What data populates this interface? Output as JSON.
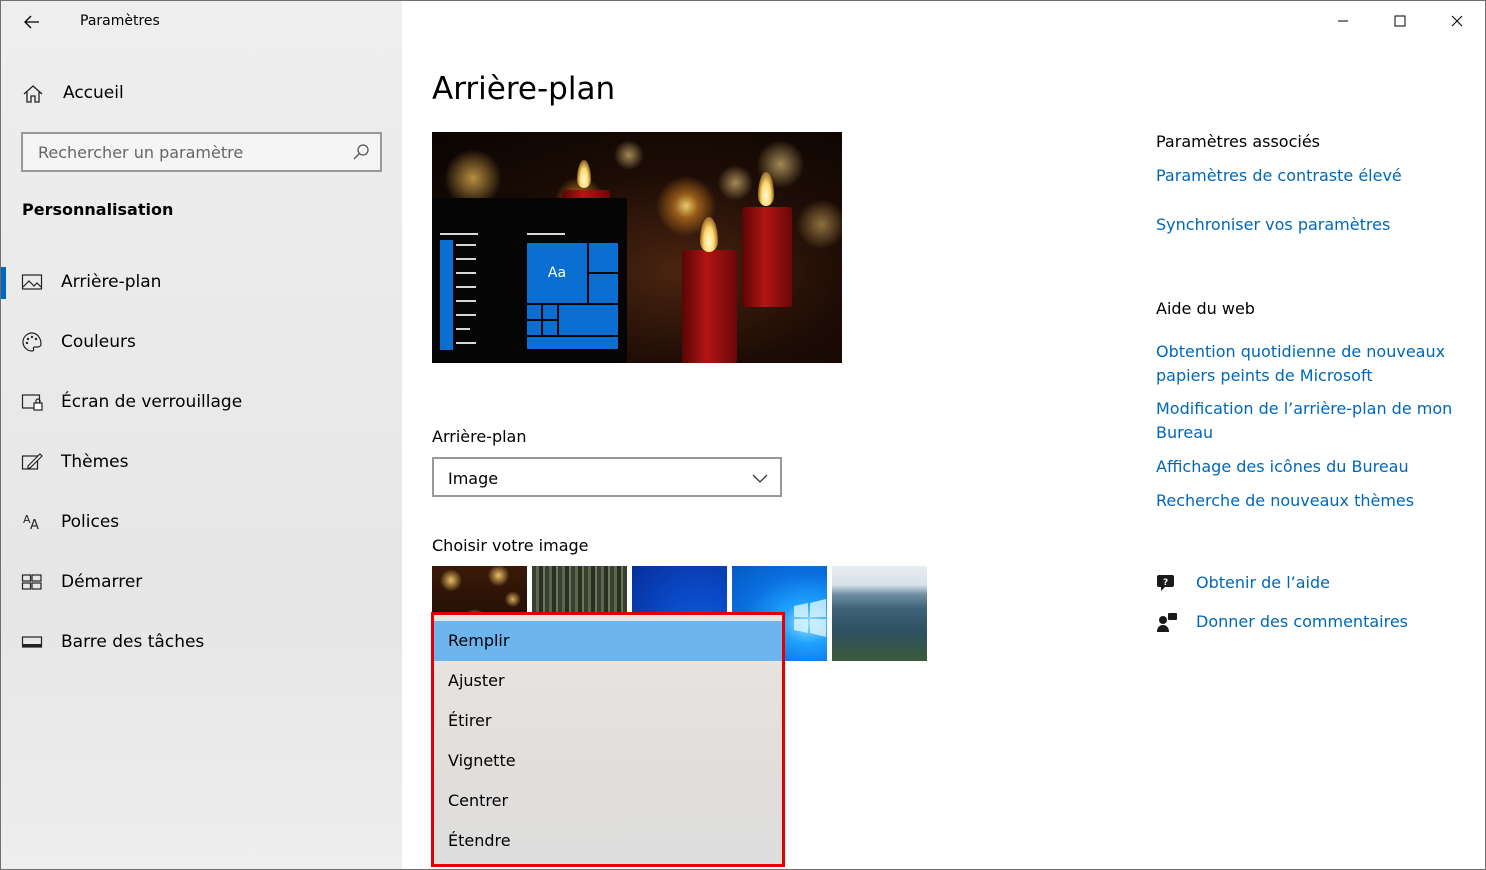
{
  "app": {
    "title": "Paramètres",
    "back_icon": "back-arrow-icon"
  },
  "window_controls": {
    "minimize_icon": "minimize-icon",
    "maximize_icon": "maximize-icon",
    "close_icon": "close-icon"
  },
  "sidebar": {
    "home_label": "Accueil",
    "search": {
      "placeholder": "Rechercher un paramètre",
      "value": ""
    },
    "section_title": "Personnalisation",
    "items": [
      {
        "label": "Arrière-plan",
        "icon": "picture-icon",
        "active": true
      },
      {
        "label": "Couleurs",
        "icon": "palette-icon",
        "active": false
      },
      {
        "label": "Écran de verrouillage",
        "icon": "lock-screen-icon",
        "active": false
      },
      {
        "label": "Thèmes",
        "icon": "themes-icon",
        "active": false
      },
      {
        "label": "Polices",
        "icon": "fonts-icon",
        "active": false
      },
      {
        "label": "Démarrer",
        "icon": "start-icon",
        "active": false
      },
      {
        "label": "Barre des tâches",
        "icon": "taskbar-icon",
        "active": false
      }
    ]
  },
  "main": {
    "title": "Arrière-plan",
    "preview_tile_text": "Aa",
    "background_label": "Arrière-plan",
    "background_value": "Image",
    "choose_image_label": "Choisir votre image",
    "fit_dropdown": {
      "options": [
        "Remplir",
        "Ajuster",
        "Étirer",
        "Vignette",
        "Centrer",
        "Étendre"
      ],
      "selected": "Remplir"
    }
  },
  "right": {
    "related_heading": "Paramètres associés",
    "related_links": [
      "Paramètres de contraste élevé",
      "Synchroniser vos paramètres"
    ],
    "web_help_heading": "Aide du web",
    "web_help_links": [
      "Obtention quotidienne de nouveaux papiers peints de Microsoft",
      "Modification de l’arrière-plan de mon Bureau",
      "Affichage des icônes du Bureau",
      "Recherche de nouveaux thèmes"
    ],
    "get_help": "Obtenir de l’aide",
    "feedback": "Donner des commentaires"
  },
  "colors": {
    "accent": "#0067c0",
    "link": "#0067b8",
    "selected_option": "#6db5ef",
    "highlight_border": "#e30000"
  }
}
